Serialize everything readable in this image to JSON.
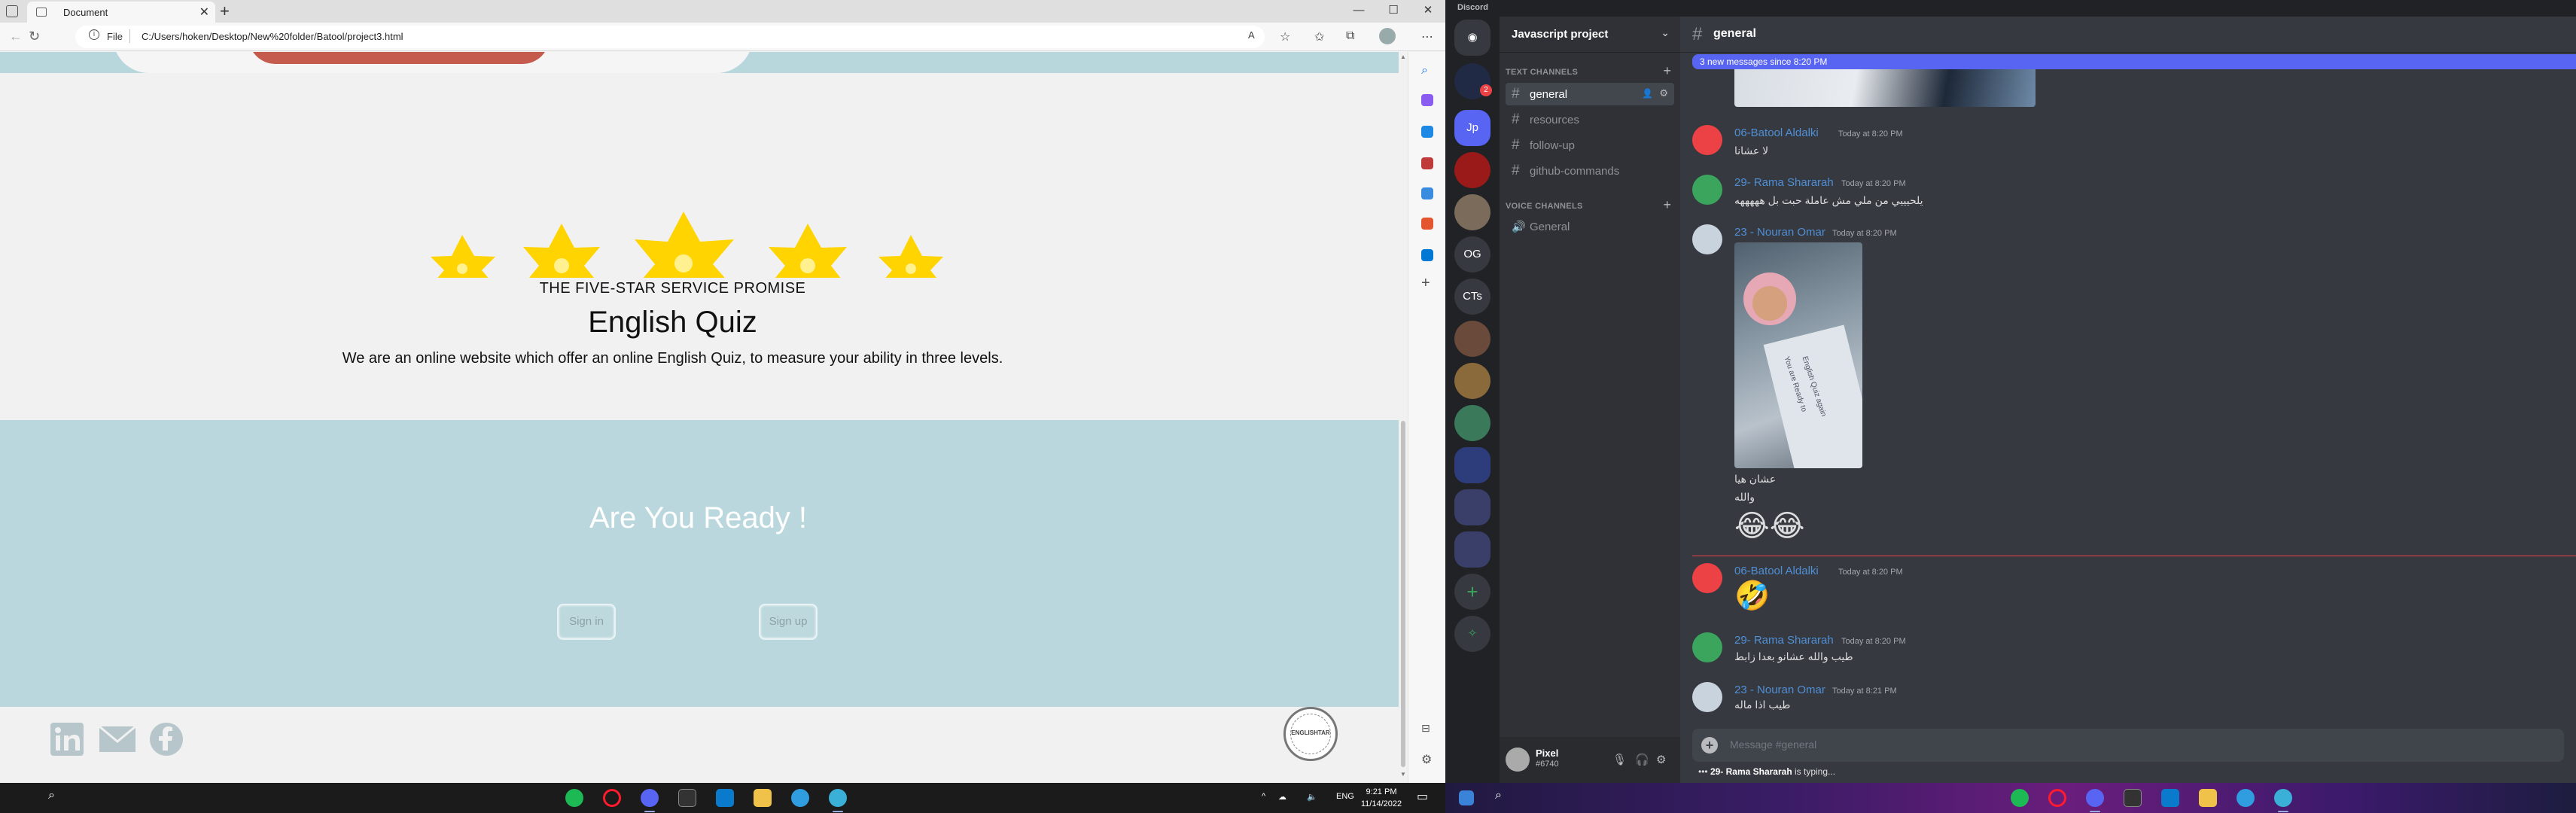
{
  "browser": {
    "tab_title": "Document",
    "tab_close": "✕",
    "new_tab": "+",
    "address_scheme": "File",
    "address_url": "C:/Users/hoken/Desktop/New%20folder/Batool/project3.html",
    "window_controls": [
      "—",
      "☐",
      "✕"
    ]
  },
  "page": {
    "promise": "THE FIVE-STAR SERVICE PROMISE",
    "title": "English Quiz",
    "description": "We are an online website which offer an online English Quiz, to measure your ability in three levels.",
    "ready_title": "Are You Ready !",
    "sign_in": "Sign in",
    "sign_up": "Sign up",
    "logo_text": "ENGLISHTAR"
  },
  "taskbar_left": {
    "language": "ENG",
    "time": "9:21 PM",
    "date": "11/14/2022"
  },
  "discord": {
    "app_title": "Discord",
    "server_name": "Javascript project",
    "guild_labels": {
      "jp": "Jp",
      "og": "OG",
      "cts": "CTs",
      "badge": "2"
    },
    "text_category": "TEXT CHANNELS",
    "voice_category": "VOICE CHANNELS",
    "text_channels": [
      "general",
      "resources",
      "follow-up",
      "github-commands"
    ],
    "voice_channels": [
      "General"
    ],
    "channel_name": "general",
    "new_messages_bar": "3 new messages since 8:20 PM",
    "messages": [
      {
        "author": "06-Batool Aldalki",
        "time": "Today at 8:20 PM",
        "text": "لا عشانا"
      },
      {
        "author": "29- Rama Shararah",
        "time": "Today at 8:20 PM",
        "text": "يلحيييي من ملي مش عاملة حبت بل هههههه"
      },
      {
        "author": "23 - Nouran Omar",
        "time": "Today at 8:20 PM",
        "lines": [
          "عشان هيا",
          "والله"
        ],
        "image_caption_1": "You are Ready to",
        "image_caption_2": "English Quiz again"
      },
      {
        "author": "06-Batool Aldalki",
        "time": "Today at 8:20 PM",
        "text": "🤣"
      },
      {
        "author": "29- Rama Shararah",
        "time": "Today at 8:20 PM",
        "text": "طيب والله عشانو بعدا زابط"
      },
      {
        "author": "23 - Nouran Omar",
        "time": "Today at 8:21 PM",
        "text": "طيب اذا ماله"
      }
    ],
    "emojis": "😂😂",
    "composer_placeholder": "Message #general",
    "typing_user": "29- Rama Shararah",
    "typing_suffix": " is typing...",
    "user_name": "Pixel",
    "user_tag": "#6740"
  },
  "colors": {
    "teal_band": "#b9d7dd",
    "star_yellow": "#ffd400",
    "discord_blurple": "#5865f2",
    "discord_link": "#4f8fd6"
  }
}
